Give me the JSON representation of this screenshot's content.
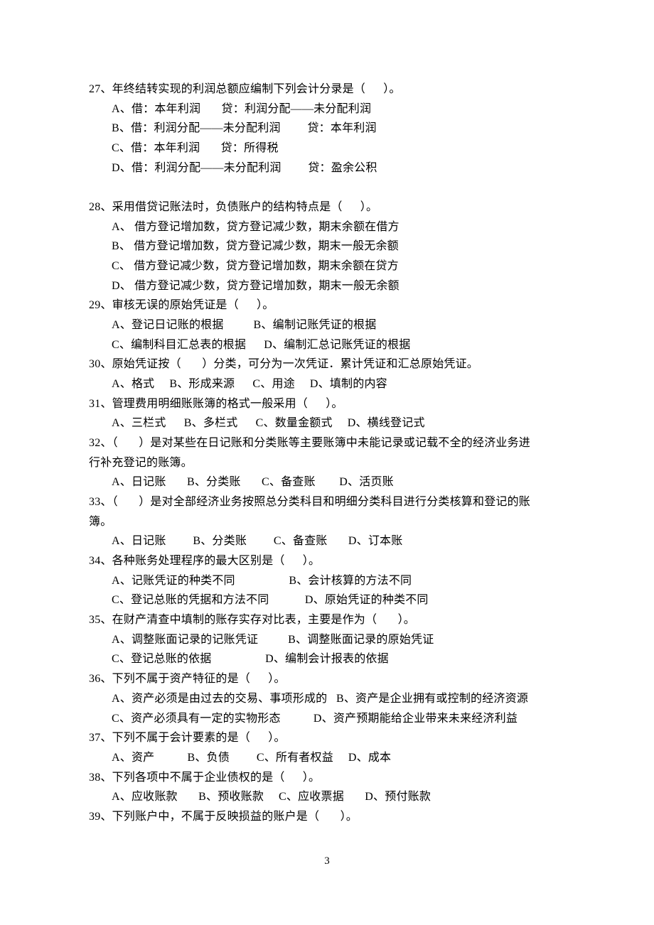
{
  "q27": {
    "stem": "27、年终结转实现的利润总额应编制下列会计分录是（      ）。",
    "a": "A、借：本年利润       贷：利润分配——未分配利润",
    "b": "B、借：利润分配——未分配利润         贷：本年利润",
    "c": "C、借：本年利润       贷：所得税",
    "d": "D、借：利润分配——未分配利润         贷：盈余公积"
  },
  "q28": {
    "stem": "28、采用借贷记账法时，负债账户的结构特点是（      ）。",
    "a": "A、 借方登记增加数，贷方登记减少数，期末余额在借方",
    "b": "B、 借方登记增加数，贷方登记减少数，期末一般无余额",
    "c": "C、 借方登记减少数，贷方登记增加数，期末余额在贷方",
    "d": "D、 借方登记减少数，贷方登记增加数，期末一般无余额"
  },
  "q29": {
    "stem": "29、审核无误的原始凭证是（      ）。",
    "l1": "A、登记日记账的根据          B、编制记账凭证的根据",
    "l2": "C、编制科目汇总表的根据      D、编制汇总记账凭证的根据"
  },
  "q30": {
    "stem": "30、原始凭证按（       ）分类，可分为一次凭证．累计凭证和汇总原始凭证。",
    "opts": "A、格式     B、形成来源      C、用途     D、填制的内容"
  },
  "q31": {
    "stem": "31、管理费用明细账账簿的格式一般采用（      ）。",
    "opts": "A、三栏式      B、多栏式      C、数量金额式     D、横线登记式"
  },
  "q32": {
    "stem1": "32、（       ）是对某些在日记账和分类账等主要账簿中未能记录或记载不全的经济业务进",
    "stem2": "行补充登记的账簿。",
    "opts": "A、日记账       B、分类账       C、备查账        D、活页账"
  },
  "q33": {
    "stem1": "33、（       ）是对全部经济业务按照总分类科目和明细分类科目进行分类核算和登记的账",
    "stem2": "簿。",
    "opts": "A、日记账         B、分类账         C、备查账       D、订本账"
  },
  "q34": {
    "stem": "34、各种账务处理程序的最大区别是（      ）。",
    "l1": "A、记账凭证的种类不同                  B、会计核算的方法不同",
    "l2": "C、登记总账的凭据和方法不同            D、原始凭证的种类不同"
  },
  "q35": {
    "stem": "35、在财产清查中填制的账存实存对比表，主要是作为（       ）。",
    "l1": "A、调整账面记录的记账凭证          B、调整账面记录的原始凭证",
    "l2": "C、登记总账的依据                  D、编制会计报表的依据"
  },
  "q36": {
    "stem": "36、下列不属于资产特征的是（      ）。",
    "l1": "A、资产必须是由过去的交易、事项形成的   B、资产是企业拥有或控制的经济资源",
    "l2": "C、资产必须具有一定的实物形态           D、资产预期能给企业带来未来经济利益"
  },
  "q37": {
    "stem": "37、下列不属于会计要素的是（      ）。",
    "opts": "A、资产           B、负债         C、所有者权益     D、成本"
  },
  "q38": {
    "stem": "38、下列各项中不属于企业债权的是（      ）。",
    "opts": "A、应收账款       B、预收账款     C、应收票据       D、预付账款"
  },
  "q39": {
    "stem": "39、下列账户中，不属于反映损益的账户是（       ）。"
  },
  "page_num": "3"
}
